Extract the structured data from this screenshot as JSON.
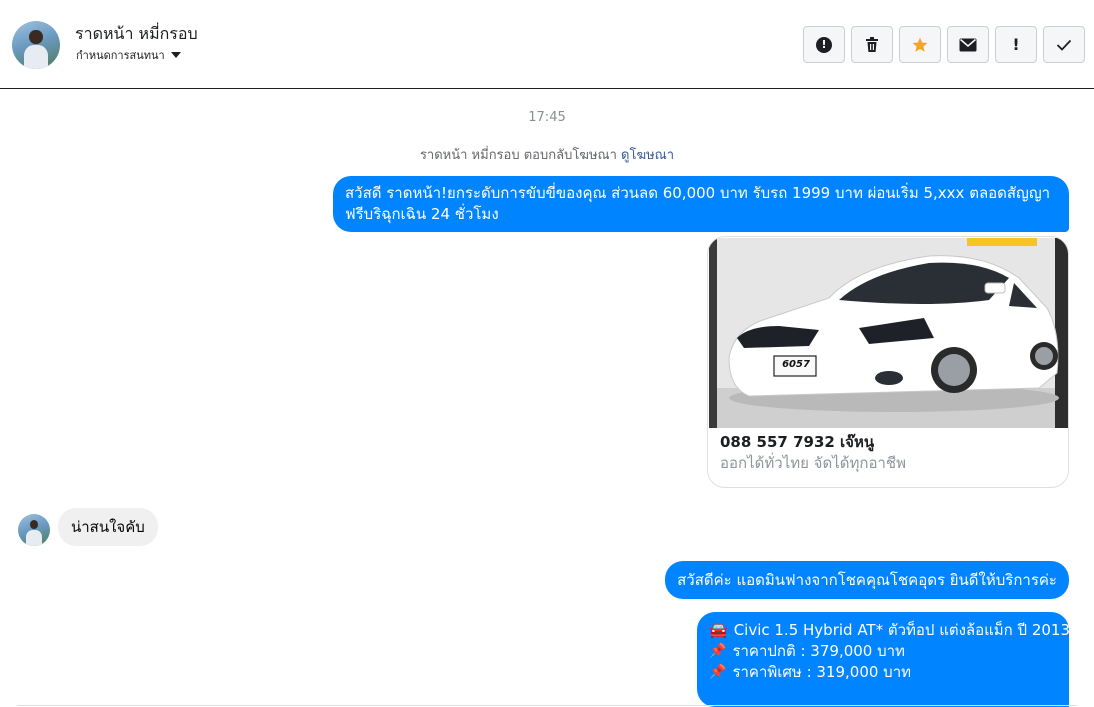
{
  "contact": {
    "name": "ราดหน้า หมี่กรอบ",
    "subtitle": "กำหนดการสนทนา"
  },
  "toolbar": {
    "buttons": [
      {
        "icon": "alert-circle-icon",
        "glyph": "!"
      },
      {
        "icon": "trash-icon",
        "glyph": "🗑"
      },
      {
        "icon": "star-icon",
        "glyph": "★"
      },
      {
        "icon": "envelope-icon",
        "glyph": "✉"
      },
      {
        "icon": "exclamation-icon",
        "glyph": "!"
      },
      {
        "icon": "checkmark-icon",
        "glyph": "✓"
      }
    ],
    "star_color": "#f5a623"
  },
  "thread": {
    "timestamp": "17:45",
    "reply_note": "ราดหน้า หมี่กรอบ ตอบกลับโฆษณา",
    "reply_link": "ดูโฆษณา",
    "message1": "สวัสดี ราดหน้า!ยกระดับการขับขี่ของคุณ ส่วนลด 60,000 บาท รับรถ 1999 บาท  ผ่อนเริ่ม 5,xxx ตลอดสัญญา ฟรีบริฉุกเฉิน 24 ชั่วโมง",
    "ad_card": {
      "plate": "6057",
      "title": "088 557 7932 เจ๊หนู",
      "subtitle": "ออกได้ทั่วไทย จัดได้ทุกอาชีพ"
    },
    "incoming": "น่าสนใจคับ",
    "message2": "สวัสดีค่ะ แอดมินฟางจากโชคคุณโชคอุดร ยินดีให้บริการค่ะ",
    "message3": {
      "line1": "Civic 1.5 Hybrid AT* ตัวท็อป แต่งล้อแม็ก ปี 2013",
      "line2": "ราคาปกติ : 379,000 บาท",
      "line3": "ราคาพิเศษ : 319,000 บาท"
    }
  },
  "colors": {
    "outgoing_bubble": "#0084ff",
    "incoming_bubble": "#f1f0f0",
    "car": "#ffffff"
  }
}
